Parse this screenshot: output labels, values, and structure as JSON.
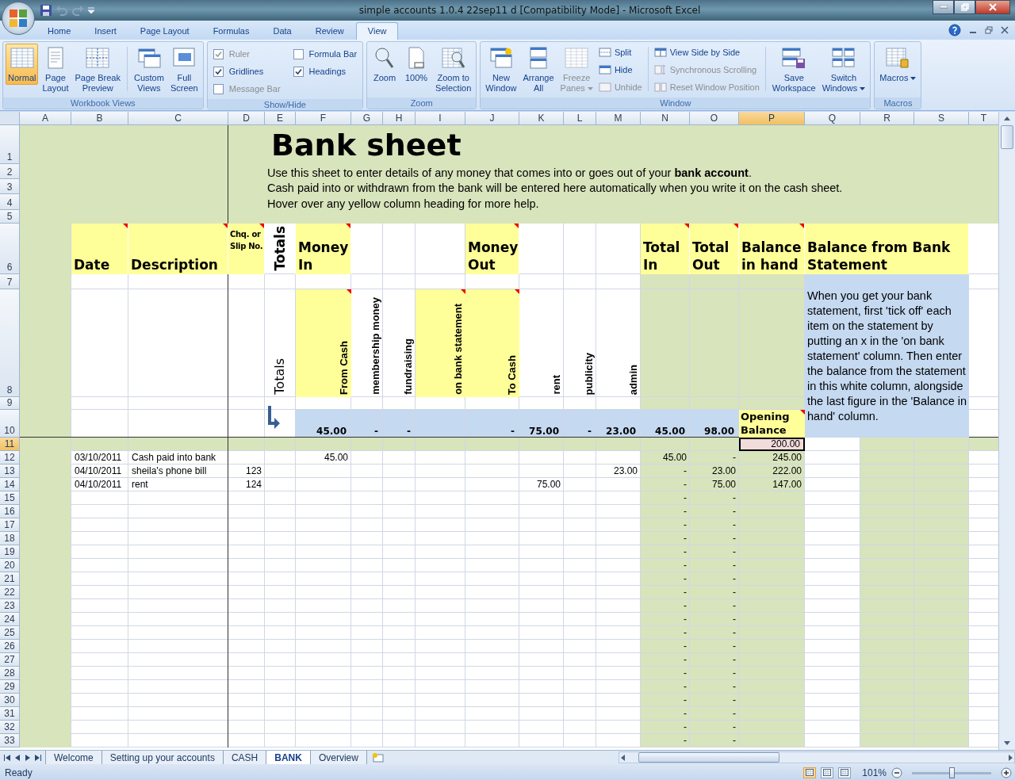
{
  "window": {
    "title": "simple accounts 1.0.4 22sep11 d  [Compatibility Mode]  -  Microsoft Excel"
  },
  "ribbon": {
    "tabs": [
      {
        "label": "Home",
        "selected": false
      },
      {
        "label": "Insert",
        "selected": false
      },
      {
        "label": "Page Layout",
        "selected": false
      },
      {
        "label": "Formulas",
        "selected": false
      },
      {
        "label": "Data",
        "selected": false
      },
      {
        "label": "Review",
        "selected": false
      },
      {
        "label": "View",
        "selected": true
      }
    ],
    "groups": [
      {
        "label": "Workbook Views",
        "items": [
          {
            "kind": "large",
            "label": "Normal",
            "selected": true
          },
          {
            "kind": "large",
            "label": "Page\nLayout",
            "selected": false
          },
          {
            "kind": "large",
            "label": "Page Break\nPreview",
            "selected": false
          },
          {
            "kind": "separator"
          },
          {
            "kind": "large",
            "label": "Custom\nViews",
            "selected": false
          },
          {
            "kind": "large",
            "label": "Full\nScreen",
            "selected": false
          }
        ]
      },
      {
        "label": "Show/Hide",
        "items": [
          {
            "kind": "check",
            "label": "Ruler",
            "checked": true,
            "disabled": true
          },
          {
            "kind": "check",
            "label": "Gridlines",
            "checked": true,
            "disabled": false
          },
          {
            "kind": "check",
            "label": "Message Bar",
            "checked": false,
            "disabled": true
          },
          {
            "kind": "check",
            "label": "Formula Bar",
            "checked": false,
            "disabled": false
          },
          {
            "kind": "check",
            "label": "Headings",
            "checked": true,
            "disabled": false
          }
        ]
      },
      {
        "label": "Zoom",
        "items": [
          {
            "kind": "large",
            "label": "Zoom"
          },
          {
            "kind": "large",
            "label": "100%"
          },
          {
            "kind": "large",
            "label": "Zoom to\nSelection"
          }
        ]
      },
      {
        "label": "Window",
        "items": [
          {
            "kind": "large",
            "label": "New\nWindow",
            "disabled": false,
            "dropdown": false
          },
          {
            "kind": "large",
            "label": "Arrange\nAll",
            "disabled": false,
            "dropdown": false
          },
          {
            "kind": "large",
            "label": "Freeze\nPanes",
            "disabled": true,
            "dropdown": true
          },
          {
            "kind": "small",
            "label": "Split",
            "disabled": false
          },
          {
            "kind": "small",
            "label": "Hide",
            "disabled": false
          },
          {
            "kind": "small",
            "label": "Unhide",
            "disabled": true
          },
          {
            "kind": "separator"
          },
          {
            "kind": "small",
            "label": "View Side by Side",
            "disabled": false
          },
          {
            "kind": "small",
            "label": "Synchronous Scrolling",
            "disabled": true
          },
          {
            "kind": "small",
            "label": "Reset Window Position",
            "disabled": true
          },
          {
            "kind": "separator"
          },
          {
            "kind": "large",
            "label": "Save\nWorkspace",
            "disabled": false,
            "dropdown": false
          },
          {
            "kind": "large",
            "label": "Switch\nWindows",
            "disabled": false,
            "dropdown": true
          }
        ]
      },
      {
        "label": "Macros",
        "items": [
          {
            "kind": "large",
            "label": "Macros",
            "dropdown": true
          }
        ]
      }
    ]
  },
  "sheet": {
    "columns": [
      {
        "label": "A",
        "selected": false
      },
      {
        "label": "B",
        "selected": false
      },
      {
        "label": "C",
        "selected": false
      },
      {
        "label": "D",
        "selected": false
      },
      {
        "label": "E",
        "selected": false
      },
      {
        "label": "F",
        "selected": false
      },
      {
        "label": "G",
        "selected": false
      },
      {
        "label": "H",
        "selected": false
      },
      {
        "label": "I",
        "selected": false
      },
      {
        "label": "J",
        "selected": false
      },
      {
        "label": "K",
        "selected": false
      },
      {
        "label": "L",
        "selected": false
      },
      {
        "label": "M",
        "selected": false
      },
      {
        "label": "N",
        "selected": false
      },
      {
        "label": "O",
        "selected": false
      },
      {
        "label": "P",
        "selected": true
      },
      {
        "label": "Q",
        "selected": false
      },
      {
        "label": "R",
        "selected": false
      },
      {
        "label": "S",
        "selected": false
      },
      {
        "label": "T",
        "selected": false
      }
    ],
    "rows": [
      {
        "label": "1",
        "selected": false
      },
      {
        "label": "2",
        "selected": false
      },
      {
        "label": "3",
        "selected": false
      },
      {
        "label": "4",
        "selected": false
      },
      {
        "label": "5",
        "selected": false
      },
      {
        "label": "6",
        "selected": false
      },
      {
        "label": "7",
        "selected": false
      },
      {
        "label": "8",
        "selected": false
      },
      {
        "label": "9",
        "selected": false
      },
      {
        "label": "10",
        "selected": false
      },
      {
        "label": "11",
        "selected": true
      },
      {
        "label": "12",
        "selected": false
      },
      {
        "label": "13",
        "selected": false
      },
      {
        "label": "14",
        "selected": false
      },
      {
        "label": "15",
        "selected": false
      },
      {
        "label": "16",
        "selected": false
      },
      {
        "label": "17",
        "selected": false
      },
      {
        "label": "18",
        "selected": false
      },
      {
        "label": "19",
        "selected": false
      },
      {
        "label": "20",
        "selected": false
      },
      {
        "label": "21",
        "selected": false
      },
      {
        "label": "22",
        "selected": false
      },
      {
        "label": "23",
        "selected": false
      },
      {
        "label": "24",
        "selected": false
      },
      {
        "label": "25",
        "selected": false
      },
      {
        "label": "26",
        "selected": false
      },
      {
        "label": "27",
        "selected": false
      },
      {
        "label": "28",
        "selected": false
      },
      {
        "label": "29",
        "selected": false
      },
      {
        "label": "30",
        "selected": false
      },
      {
        "label": "31",
        "selected": false
      },
      {
        "label": "32",
        "selected": false
      },
      {
        "label": "33",
        "selected": false
      }
    ],
    "title": "Bank sheet",
    "intro": [
      "Use this sheet to enter details of any money that comes into or goes out of your **bank account**.",
      "Cash paid into or withdrawn from the bank will be entered here automatically when you write it on the cash sheet.",
      "Hover over any yellow column heading for more help."
    ],
    "headers": [
      {
        "kind": "heading",
        "label": "Date",
        "highlight": true,
        "comment": true
      },
      {
        "kind": "heading",
        "label": "Description",
        "highlight": true,
        "comment": true
      },
      {
        "kind": "note",
        "label": "Chq. or Slip No.",
        "highlight": true,
        "comment": true
      },
      {
        "kind": "rotated",
        "label": "Totals",
        "highlight": false,
        "comment": false
      },
      {
        "kind": "heading",
        "label": "Money In",
        "highlight": true,
        "comment": true
      },
      {
        "kind": "heading",
        "label": "Money Out",
        "highlight": true,
        "comment": true
      },
      {
        "kind": "heading",
        "label": "Total In",
        "highlight": true,
        "comment": true
      },
      {
        "kind": "heading",
        "label": "Total Out",
        "highlight": true,
        "comment": true
      },
      {
        "kind": "heading",
        "label": "Balance in hand",
        "highlight": true,
        "comment": true
      },
      {
        "kind": "heading",
        "label": "Balance from Bank Statement",
        "highlight": true,
        "comment": false
      }
    ],
    "sub_headers": [
      {
        "label": "Totals",
        "highlight": false,
        "comment": false
      },
      {
        "label": "From Cash",
        "highlight": true,
        "comment": true
      },
      {
        "label": "membership money",
        "highlight": false,
        "comment": false
      },
      {
        "label": "fundraising",
        "highlight": false,
        "comment": false
      },
      {
        "label": "on bank statement",
        "highlight": true,
        "comment": true
      },
      {
        "label": "To Cash",
        "highlight": true,
        "comment": true
      },
      {
        "label": "rent",
        "highlight": false,
        "comment": false
      },
      {
        "label": "publicity",
        "highlight": false,
        "comment": false
      },
      {
        "label": "admin",
        "highlight": false,
        "comment": false
      }
    ],
    "help": "When you get your bank statement, first 'tick off' each item on the statement by putting an x in the 'on bank statement' column.  Then enter the balance from the statement in this white column, alongside the last figure in the 'Balance in hand' column.",
    "money_in_totals": [
      "45.00",
      "-",
      "-"
    ],
    "money_out_totals": [
      "-",
      "75.00",
      "-",
      "23.00"
    ],
    "total_in": "45.00",
    "total_out": "98.00",
    "opening": {
      "label": "Opening Balance",
      "comment": true,
      "value": "200.00"
    },
    "entries": [
      {
        "date": "03/10/2011",
        "description": "Cash paid into bank",
        "amounts": {
          "from_cash": "45.00"
        },
        "total_in": "45.00",
        "total_out": "-",
        "balance": "245.00"
      },
      {
        "date": "04/10/2011",
        "description": "sheila's phone bill",
        "cheque": "123",
        "amounts": {
          "admin": "23.00"
        },
        "total_in": "-",
        "total_out": "23.00",
        "balance": "222.00"
      },
      {
        "date": "04/10/2011",
        "description": "rent",
        "cheque": "124",
        "amounts": {
          "rent": "75.00"
        },
        "total_in": "-",
        "total_out": "75.00",
        "balance": "147.00"
      },
      {
        "total_in": "-",
        "total_out": "-"
      },
      {
        "total_in": "-",
        "total_out": "-"
      },
      {
        "total_in": "-",
        "total_out": "-"
      },
      {
        "total_in": "-",
        "total_out": "-"
      },
      {
        "total_in": "-",
        "total_out": "-"
      },
      {
        "total_in": "-",
        "total_out": "-"
      },
      {
        "total_in": "-",
        "total_out": "-"
      },
      {
        "total_in": "-",
        "total_out": "-"
      },
      {
        "total_in": "-",
        "total_out": "-"
      },
      {
        "total_in": "-",
        "total_out": "-"
      },
      {
        "total_in": "-",
        "total_out": "-"
      },
      {
        "total_in": "-",
        "total_out": "-"
      },
      {
        "total_in": "-",
        "total_out": "-"
      },
      {
        "total_in": "-",
        "total_out": "-"
      },
      {
        "total_in": "-",
        "total_out": "-"
      },
      {
        "total_in": "-",
        "total_out": "-"
      },
      {
        "total_in": "-",
        "total_out": "-"
      },
      {
        "total_in": "-",
        "total_out": "-"
      },
      {
        "total_in": "-",
        "total_out": "-"
      }
    ]
  },
  "sheet_tabs": [
    {
      "label": "Welcome",
      "selected": false
    },
    {
      "label": "Setting up your accounts",
      "selected": false
    },
    {
      "label": "CASH",
      "selected": false
    },
    {
      "label": "BANK",
      "selected": true
    },
    {
      "label": "Overview",
      "selected": false
    }
  ],
  "status_bar": {
    "text": "Ready",
    "views": [
      {
        "selected": true
      },
      {
        "selected": false
      },
      {
        "selected": false
      }
    ],
    "zoom": "101%",
    "zoom_slider": {
      "level": 0.5
    }
  }
}
